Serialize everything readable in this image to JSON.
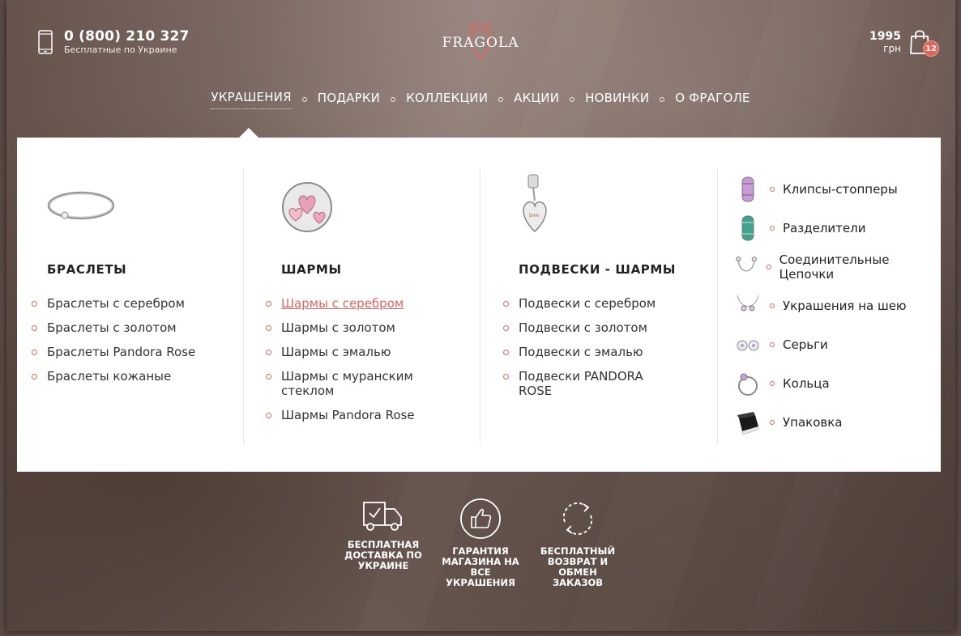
{
  "header": {
    "phone_number": "0 (800) 210 327",
    "phone_note": "Бесплатные по Украине",
    "logo_text": "FRAGOLA",
    "cart_amount": "1995",
    "cart_currency": "грн",
    "cart_count": "12"
  },
  "nav": {
    "items": [
      {
        "label": "УКРАШЕНИЯ"
      },
      {
        "label": "ПОДАРКИ"
      },
      {
        "label": "КОЛЛЕКЦИИ"
      },
      {
        "label": "АКЦИИ"
      },
      {
        "label": "НОВИНКИ"
      },
      {
        "label": "О ФРАГОЛЕ"
      }
    ]
  },
  "menu": {
    "columns": [
      {
        "title": "БРАСЛЕТЫ",
        "links": [
          "Браслеты с серебром",
          "Браслеты с золотом",
          "Браслеты Pandora Rose",
          "Браслеты кожаные"
        ]
      },
      {
        "title": "ШАРМЫ",
        "links": [
          "Шармы с серебром",
          "Шармы с золотом",
          "Шармы с эмалью",
          "Шармы с муранским стеклом",
          "Шармы Pandora Rose"
        ]
      },
      {
        "title": "ПОДВЕСКИ - ШАРМЫ",
        "links": [
          "Подвески с серебром",
          "Подвески с золотом",
          "Подвески с эмалью",
          "Подвески PANDORA ROSE"
        ]
      }
    ],
    "side_items": [
      {
        "label": "Клипсы-стопперы",
        "icon": "clip-stopper-icon"
      },
      {
        "label": "Разделители",
        "icon": "spacer-icon"
      },
      {
        "label": "Соединительные Цепочки",
        "icon": "safety-chain-icon"
      },
      {
        "label": "Украшения на шею",
        "icon": "necklace-icon"
      },
      {
        "label": "Серьги",
        "icon": "earrings-icon"
      },
      {
        "label": "Кольца",
        "icon": "ring-icon"
      },
      {
        "label": "Упаковка",
        "icon": "gift-box-icon"
      }
    ]
  },
  "features": [
    {
      "text": "Бесплатная доставка по Украине",
      "icon": "delivery-truck-icon"
    },
    {
      "text": "Гарантия магазина на все украшения",
      "icon": "thumbs-up-icon"
    },
    {
      "text": "Бесплатный возврат и обмен заказов",
      "icon": "refresh-icon"
    }
  ],
  "colors": {
    "accent": "#e2655b",
    "text": "#222222"
  }
}
